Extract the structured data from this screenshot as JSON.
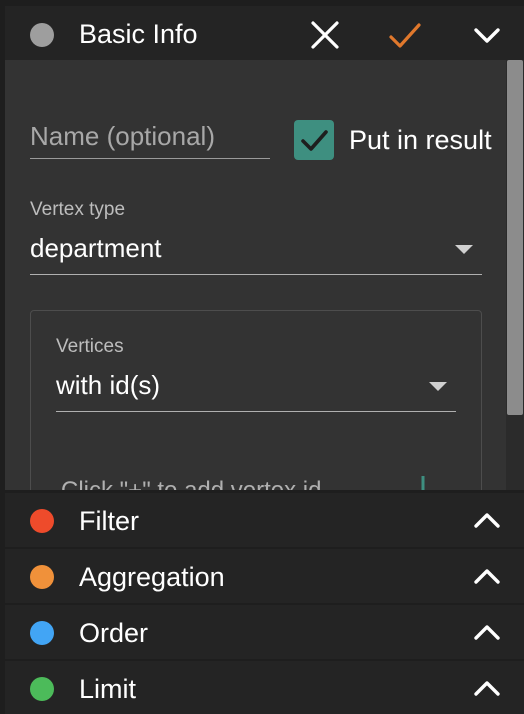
{
  "basic_info": {
    "title": "Basic Info",
    "dot_color": "#9e9e9e",
    "icons": {
      "close": "close-icon",
      "confirm": "check-icon",
      "collapse": "chevron-down-icon"
    },
    "accent_color": "#e0782c"
  },
  "form": {
    "name_placeholder": "Name (optional)",
    "name_value": "",
    "put_in_result": {
      "label": "Put in result",
      "checked": true,
      "color": "#3e8f80"
    },
    "vertex_type": {
      "label": "Vertex type",
      "value": "department"
    },
    "vertices": {
      "label": "Vertices",
      "value": "with id(s)",
      "id_placeholder": "Click \"+\" to add vertex id"
    }
  },
  "sections": [
    {
      "label": "Filter",
      "dot_color": "#ee4b2b",
      "icon": "chevron-up-icon"
    },
    {
      "label": "Aggregation",
      "dot_color": "#f0913a",
      "icon": "chevron-up-icon"
    },
    {
      "label": "Order",
      "dot_color": "#42a5f5",
      "icon": "chevron-up-icon"
    },
    {
      "label": "Limit",
      "dot_color": "#4cbb5a",
      "icon": "chevron-up-icon"
    }
  ]
}
